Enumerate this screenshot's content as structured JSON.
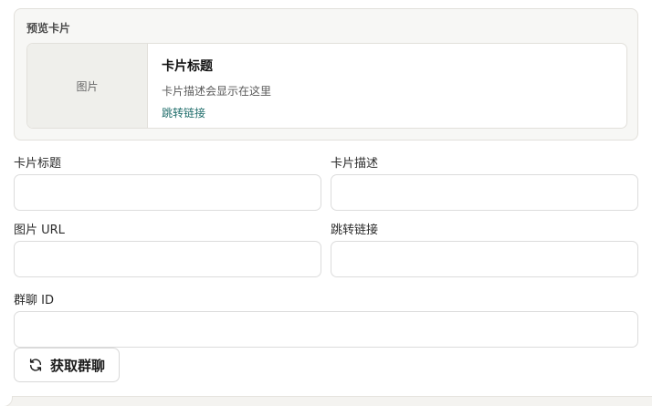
{
  "preview": {
    "section_title": "预览卡片",
    "card": {
      "image_placeholder": "图片",
      "title": "卡片标题",
      "description": "卡片描述会显示在这里",
      "link_text": "跳转链接"
    }
  },
  "form": {
    "card_title": {
      "label": "卡片标题",
      "value": "",
      "placeholder": ""
    },
    "card_description": {
      "label": "卡片描述",
      "value": "",
      "placeholder": ""
    },
    "image_url": {
      "label": "图片 URL",
      "value": "",
      "placeholder": ""
    },
    "jump_link": {
      "label": "跳转链接",
      "value": "",
      "placeholder": ""
    },
    "group_id": {
      "label": "群聊 ID",
      "value": "",
      "placeholder": ""
    }
  },
  "actions": {
    "fetch_groups_label": "获取群聊",
    "fetch_groups_icon": "refresh-icon"
  },
  "colors": {
    "link": "#1e6c6a",
    "panel_bg": "#f7f7f5",
    "border": "#e2e0db"
  }
}
